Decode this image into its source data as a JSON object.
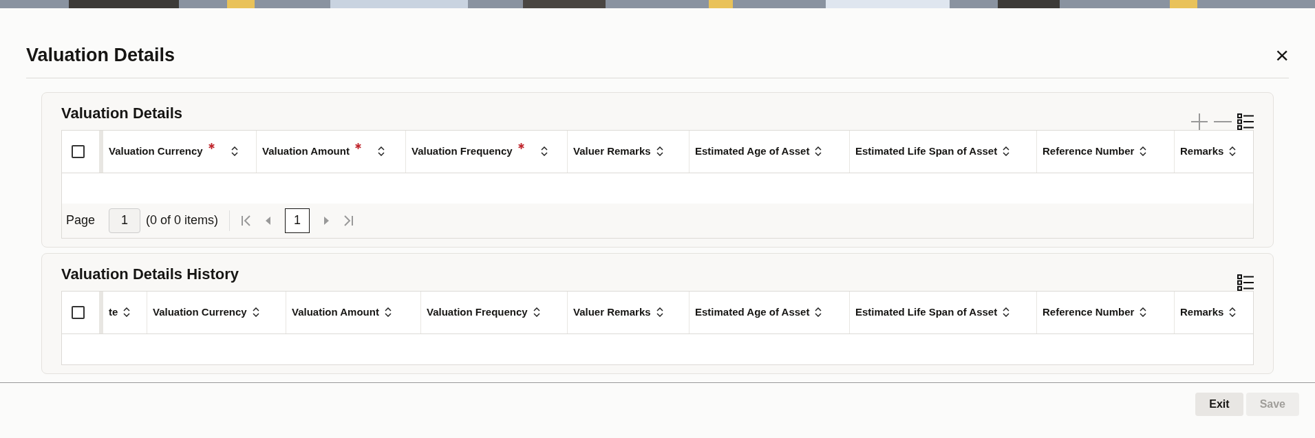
{
  "dialog": {
    "title": "Valuation Details",
    "close_icon": "×"
  },
  "sections": [
    {
      "title": "Valuation Details",
      "toolbar": [
        {
          "kind": "add"
        },
        {
          "kind": "remove"
        },
        {
          "kind": "columns"
        }
      ],
      "select_all": {
        "checked": false
      },
      "columns": [
        {
          "label": "Valuation Currency",
          "required": true
        },
        {
          "label": "Valuation Amount",
          "required": true
        },
        {
          "label": "Valuation Frequency",
          "required": true
        },
        {
          "label": "Valuer Remarks",
          "required": false
        },
        {
          "label": "Estimated Age of Asset",
          "required": false
        },
        {
          "label": "Estimated Life Span of Asset",
          "required": false
        },
        {
          "label": "Reference Number",
          "required": false
        },
        {
          "label": "Remarks",
          "required": false
        }
      ],
      "pager": {
        "label": "Page",
        "page": "1",
        "summary": "(0 of 0 items)",
        "current": "1"
      }
    },
    {
      "title": "Valuation Details History",
      "toolbar": [
        {
          "kind": "columns"
        }
      ],
      "select_all": {
        "checked": false
      },
      "columns": [
        {
          "label": "te",
          "required": false
        },
        {
          "label": "Valuation Currency",
          "required": false
        },
        {
          "label": "Valuation Amount",
          "required": false
        },
        {
          "label": "Valuation Frequency",
          "required": false
        },
        {
          "label": "Valuer Remarks",
          "required": false
        },
        {
          "label": "Estimated Age of Asset",
          "required": false
        },
        {
          "label": "Estimated Life Span of Asset",
          "required": false
        },
        {
          "label": "Reference Number",
          "required": false
        },
        {
          "label": "Remarks",
          "required": false
        }
      ]
    }
  ],
  "buttons": [
    {
      "label": "Exit",
      "disabled": false
    },
    {
      "label": "Save",
      "disabled": true
    }
  ]
}
